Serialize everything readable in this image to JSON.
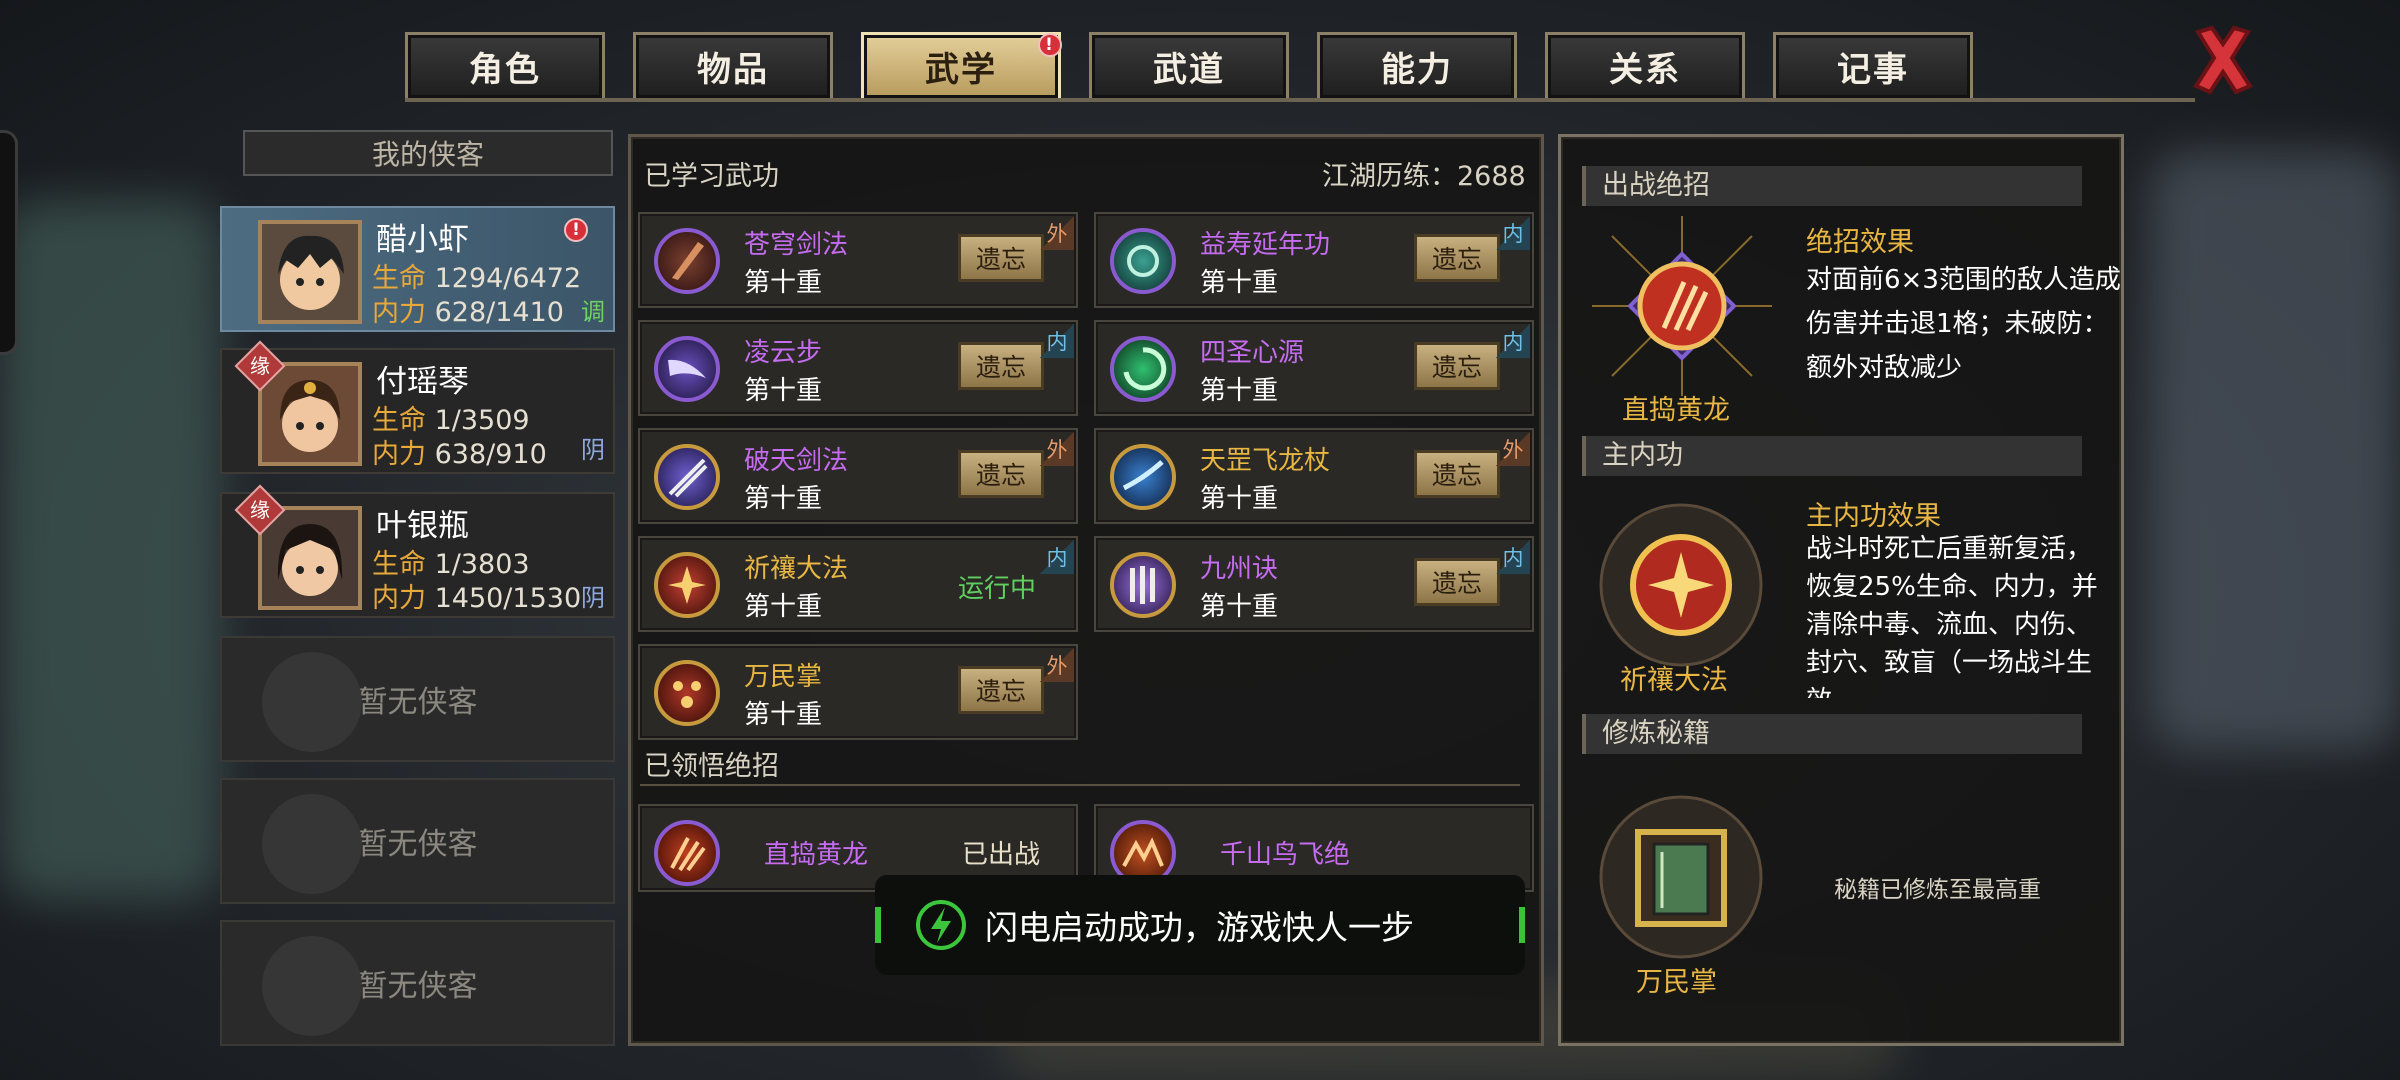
{
  "tabs": [
    {
      "label": "角色",
      "active": false
    },
    {
      "label": "物品",
      "active": false
    },
    {
      "label": "武学",
      "active": true,
      "badge": "!"
    },
    {
      "label": "武道",
      "active": false
    },
    {
      "label": "能力",
      "active": false
    },
    {
      "label": "关系",
      "active": false
    },
    {
      "label": "记事",
      "active": false
    }
  ],
  "roster": {
    "header": "我的侠客",
    "heroes": [
      {
        "name": "醋小虾",
        "hp_label": "生命",
        "hp": "1294/6472",
        "mp_label": "内力",
        "mp": "628/1410",
        "tag": "调",
        "alert": "!",
        "yuan": ""
      },
      {
        "name": "付瑶琴",
        "hp_label": "生命",
        "hp": "1/3509",
        "mp_label": "内力",
        "mp": "638/910",
        "tag": "阴",
        "yuan": "缘"
      },
      {
        "name": "叶银瓶",
        "hp_label": "生命",
        "hp": "1/3803",
        "mp_label": "内力",
        "mp": "1450/1530",
        "tag": "阴",
        "yuan": "缘"
      }
    ],
    "empty_slots": [
      "暂无侠客",
      "暂无侠客",
      "暂无侠客"
    ]
  },
  "learned": {
    "title": "已学习武功",
    "exp_label": "江湖历练：2688",
    "skills": [
      {
        "name": "苍穹剑法",
        "level": "第十重",
        "action": "遗忘",
        "type": "外",
        "color": "purple"
      },
      {
        "name": "益寿延年功",
        "level": "第十重",
        "action": "遗忘",
        "type": "内",
        "color": "purple"
      },
      {
        "name": "凌云步",
        "level": "第十重",
        "action": "遗忘",
        "type": "内",
        "color": "purple"
      },
      {
        "name": "四圣心源",
        "level": "第十重",
        "action": "遗忘",
        "type": "内",
        "color": "purple"
      },
      {
        "name": "破天剑法",
        "level": "第十重",
        "action": "遗忘",
        "type": "外",
        "color": "purple"
      },
      {
        "name": "天罡飞龙杖",
        "level": "第十重",
        "action": "遗忘",
        "type": "外",
        "color": "gold"
      },
      {
        "name": "祈禳大法",
        "level": "第十重",
        "action": "运行中",
        "type": "内",
        "color": "gold"
      },
      {
        "name": "九州诀",
        "level": "第十重",
        "action": "遗忘",
        "type": "内",
        "color": "purple"
      },
      {
        "name": "万民掌",
        "level": "第十重",
        "action": "遗忘",
        "type": "外",
        "color": "gold"
      }
    ]
  },
  "ultimates": {
    "title": "已领悟绝招",
    "items": [
      {
        "name": "直捣黄龙",
        "status": "已出战"
      },
      {
        "name": "千山鸟飞绝",
        "status": ""
      }
    ]
  },
  "right": {
    "battle": {
      "title": "出战绝招",
      "name": "直捣黄龙",
      "effect_title": "绝招效果",
      "effect": "对面前6×3范围的敌人造成伤害并击退1格；未破防：额外对敌减少"
    },
    "inner": {
      "title": "主内功",
      "name": "祈禳大法",
      "effect_title": "主内功效果",
      "effect": "战斗时死亡后重新复活，恢复25%生命、内力，并清除中毒、流血、内伤、封穴、致盲（一场战斗生效"
    },
    "book": {
      "title": "修炼秘籍",
      "name": "万民掌",
      "status": "秘籍已修炼至最高重"
    }
  },
  "toast": {
    "text": "闪电启动成功，游戏快人一步"
  }
}
